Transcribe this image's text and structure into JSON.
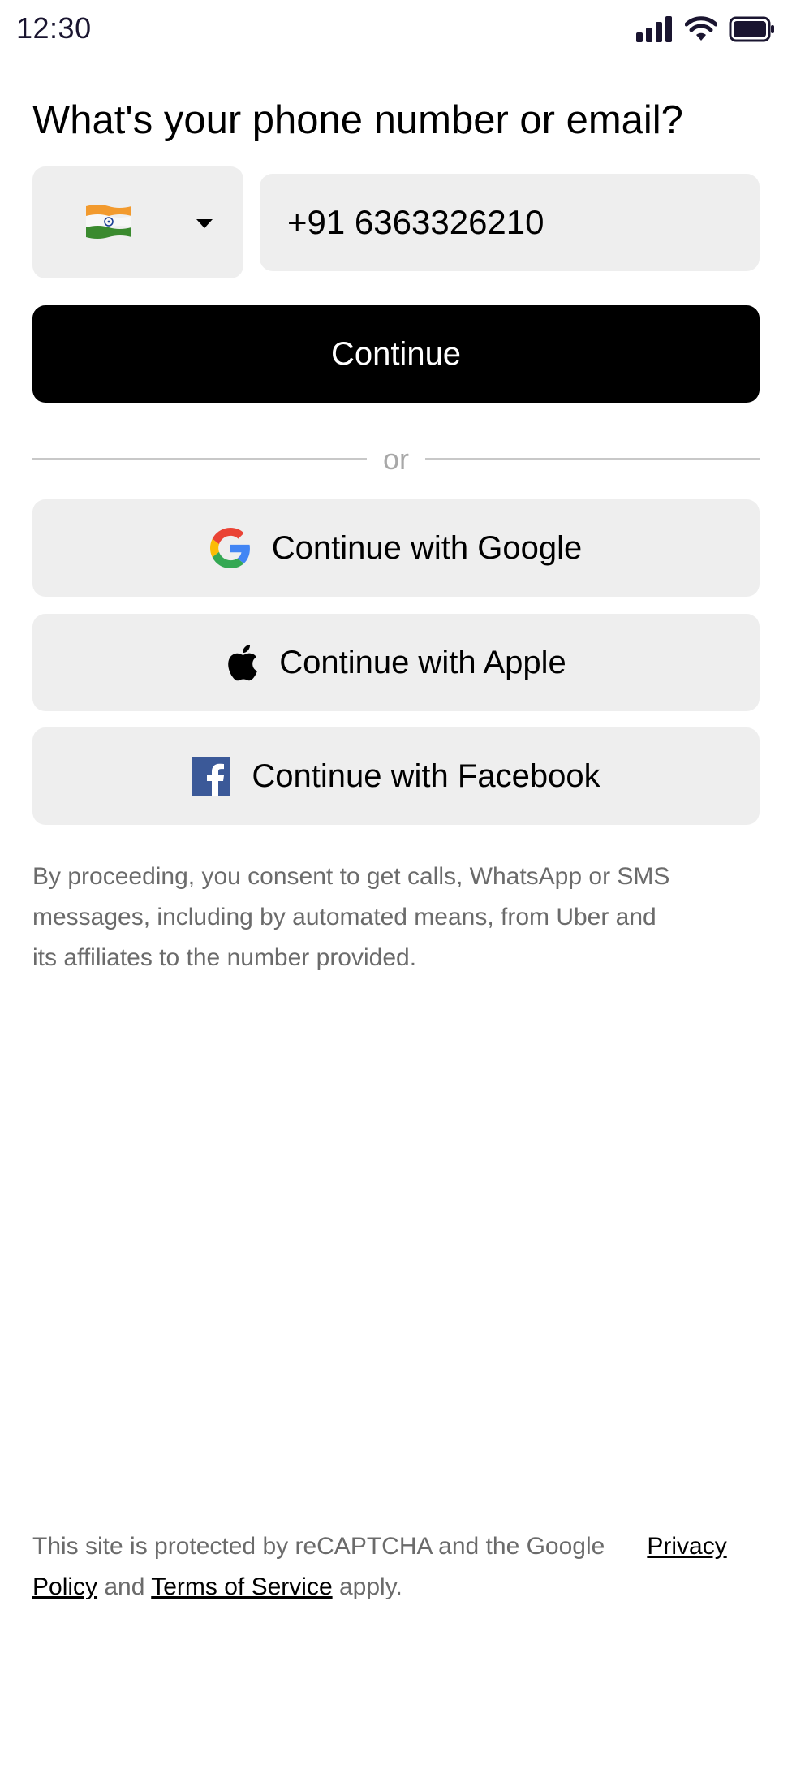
{
  "status_bar": {
    "time": "12:30",
    "icons": [
      "signal-icon",
      "wifi-icon",
      "battery-icon"
    ]
  },
  "heading": "What's your phone number or email?",
  "country_select": {
    "flag_icon": "india-flag-icon",
    "dropdown_icon": "caret-down-icon"
  },
  "phone_input": {
    "value": "+91 6363326210"
  },
  "continue_button": {
    "label": "Continue"
  },
  "divider": {
    "text": "or"
  },
  "social_buttons": {
    "google": {
      "label": "Continue with Google",
      "icon": "google-icon"
    },
    "apple": {
      "label": "Continue with Apple",
      "icon": "apple-icon"
    },
    "facebook": {
      "label": "Continue with Facebook",
      "icon": "facebook-icon"
    }
  },
  "consent_text": "By proceeding, you consent to get calls, WhatsApp or SMS messages, including by automated means, from Uber and its affiliates to the number provided.",
  "recaptcha": {
    "prefix": "This site is protected by reCAPTCHA and the Google",
    "privacy_link": "Privacy Policy",
    "and": "and",
    "terms_link": "Terms of Service",
    "suffix": "apply."
  },
  "colors": {
    "primary_button": "#000000",
    "secondary_button": "#eeeeee",
    "muted_text": "#6b6b6b",
    "divider": "#c8c8c8"
  }
}
